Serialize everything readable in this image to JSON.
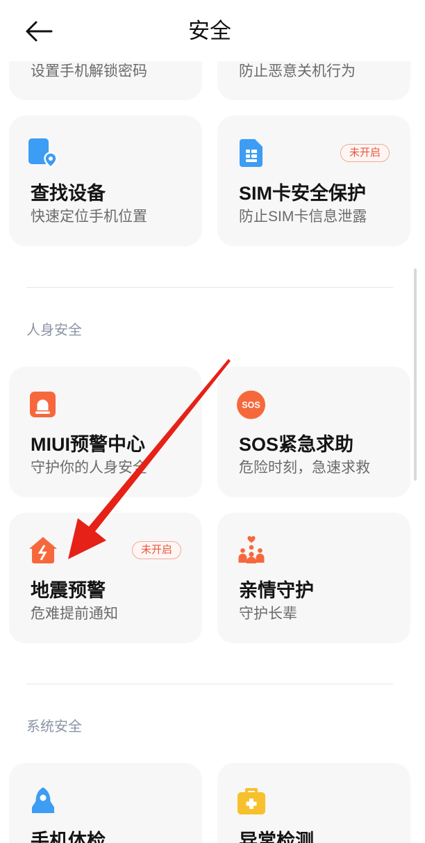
{
  "header": {
    "title": "安全",
    "back_icon": "back-arrow-icon"
  },
  "top_group": {
    "partial_cards": [
      {
        "subtitle": "设置手机解锁密码"
      },
      {
        "subtitle": "防止恶意关机行为"
      }
    ],
    "cards": [
      {
        "icon": "find-device-icon",
        "title": "查找设备",
        "subtitle": "快速定位手机位置"
      },
      {
        "icon": "sim-card-icon",
        "title": "SIM卡安全保护",
        "subtitle": "防止SIM卡信息泄露",
        "badge": "未开启"
      }
    ]
  },
  "personal_safety": {
    "title": "人身安全",
    "cards": [
      {
        "icon": "alert-center-icon",
        "title": "MIUI预警中心",
        "subtitle": "守护你的人身安全"
      },
      {
        "icon": "sos-icon",
        "icon_text": "SOS",
        "title": "SOS紧急求助",
        "subtitle": "危险时刻，急速求救"
      },
      {
        "icon": "earthquake-alert-icon",
        "title": "地震预警",
        "subtitle": "危难提前通知",
        "badge": "未开启"
      },
      {
        "icon": "family-guard-icon",
        "title": "亲情守护",
        "subtitle": "守护长辈"
      }
    ]
  },
  "system_safety": {
    "title": "系统安全",
    "cards": [
      {
        "icon": "phone-checkup-icon",
        "title": "手机体检"
      },
      {
        "icon": "anomaly-detection-icon",
        "title": "异常检测"
      }
    ]
  },
  "colors": {
    "card_background": "#f7f7f7",
    "badge": "#e8553e",
    "section_label": "#8b93a5",
    "blue_icon": "#3d9cf3",
    "orange_icon": "#f6683c",
    "yellow_icon": "#f6c12c",
    "annotation_arrow": "#e62117"
  }
}
